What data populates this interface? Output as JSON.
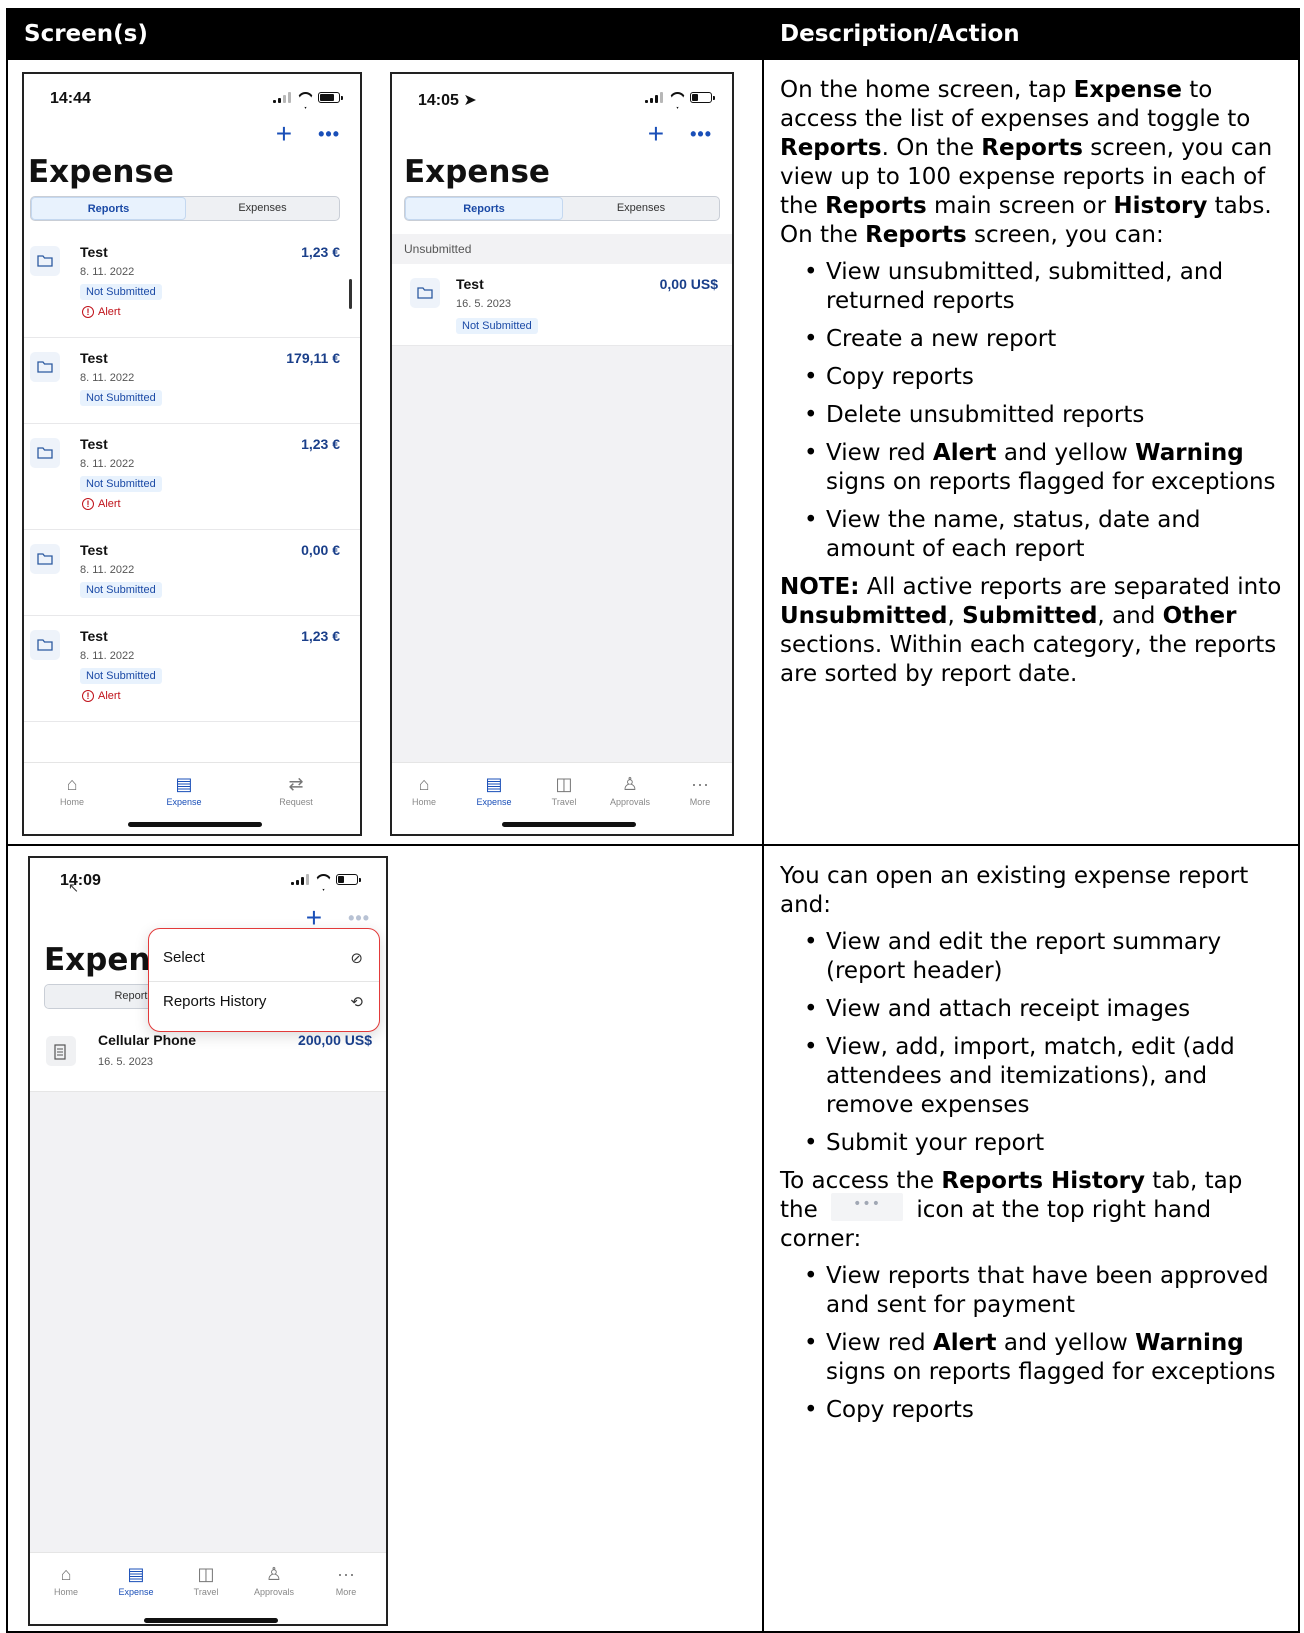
{
  "table_header": {
    "col1": "Screen(s)",
    "col2": "Description/Action"
  },
  "shot1": {
    "time": "14:44",
    "title": "Expense",
    "seg": [
      "Reports",
      "Expenses"
    ],
    "rows": [
      {
        "name": "Test",
        "date": "8. 11. 2022",
        "amount": "1,23 €",
        "status": "Not Submitted",
        "alert": "Alert"
      },
      {
        "name": "Test",
        "date": "8. 11. 2022",
        "amount": "179,11 €",
        "status": "Not Submitted",
        "alert": ""
      },
      {
        "name": "Test",
        "date": "8. 11. 2022",
        "amount": "1,23 €",
        "status": "Not Submitted",
        "alert": "Alert"
      },
      {
        "name": "Test",
        "date": "8. 11. 2022",
        "amount": "0,00 €",
        "status": "Not Submitted",
        "alert": ""
      },
      {
        "name": "Test",
        "date": "8. 11. 2022",
        "amount": "1,23 €",
        "status": "Not Submitted",
        "alert": "Alert"
      }
    ],
    "tabs": [
      "Home",
      "Expense",
      "Request"
    ]
  },
  "shot2": {
    "time": "14:05",
    "title": "Expense",
    "seg": [
      "Reports",
      "Expenses"
    ],
    "section": "Unsubmitted",
    "row": {
      "name": "Test",
      "date": "16. 5. 2023",
      "amount": "0,00 US$",
      "status": "Not Submitted"
    },
    "tabs": [
      "Home",
      "Expense",
      "Travel",
      "Approvals",
      "More"
    ]
  },
  "shot3": {
    "time": "14:09",
    "title": "Expens",
    "seg_label": "Reports",
    "menu": [
      "Select",
      "Reports History"
    ],
    "row": {
      "name": "Cellular Phone",
      "date": "16. 5. 2023",
      "amount": "200,00 US$"
    },
    "tabs": [
      "Home",
      "Expense",
      "Travel",
      "Approvals",
      "More"
    ]
  },
  "desc1": {
    "p1": [
      {
        "t": "On the home screen, tap "
      },
      {
        "b": "Expense"
      },
      {
        "t": " to access the list of expenses and toggle to "
      },
      {
        "b": "Reports"
      },
      {
        "t": ". On the "
      },
      {
        "b": "Reports"
      },
      {
        "t": " screen, you can view up to 100 expense reports in each of the "
      },
      {
        "b": "Reports"
      },
      {
        "t": " main screen or "
      },
      {
        "b": "History"
      },
      {
        "t": " tabs. On the "
      },
      {
        "b": "Reports"
      },
      {
        "t": " screen, you can:"
      }
    ],
    "bullets": [
      [
        {
          "t": "View unsubmitted, submitted, and returned reports"
        }
      ],
      [
        {
          "t": "Create a new report"
        }
      ],
      [
        {
          "t": "Copy reports"
        }
      ],
      [
        {
          "t": "Delete unsubmitted reports"
        }
      ],
      [
        {
          "t": "View red "
        },
        {
          "b": "Alert"
        },
        {
          "t": " and yellow "
        },
        {
          "b": "Warning"
        },
        {
          "t": " signs on reports flagged for exceptions"
        }
      ],
      [
        {
          "t": "View the name, status, date and amount of each report"
        }
      ]
    ],
    "note": [
      {
        "b": "NOTE:"
      },
      {
        "t": " All active reports are separated into "
      },
      {
        "b": "Unsubmitted"
      },
      {
        "t": ", "
      },
      {
        "b": "Submitted"
      },
      {
        "t": ", and "
      },
      {
        "b": "Other"
      },
      {
        "t": " sections. Within each category, the reports are sorted by report date."
      }
    ]
  },
  "desc2": {
    "p1": [
      {
        "t": "You can open an existing expense report and:"
      }
    ],
    "bullets1": [
      [
        {
          "t": "View and edit the report summary (report header)"
        }
      ],
      [
        {
          "t": "View and attach receipt images"
        }
      ],
      [
        {
          "t": "View, add, import, match, edit (add attendees and itemizations), and remove expenses"
        }
      ],
      [
        {
          "t": "Submit your report"
        }
      ]
    ],
    "p2a": [
      {
        "t": "To access the "
      },
      {
        "b": "Reports History"
      },
      {
        "t": " tab, tap the"
      }
    ],
    "more_icon": "•••",
    "p2b": [
      {
        "t": "icon at the top right hand corner:"
      }
    ],
    "bullets2": [
      [
        {
          "t": "View reports that have been approved and sent for payment"
        }
      ],
      [
        {
          "t": "View red "
        },
        {
          "b": "Alert"
        },
        {
          "t": " and yellow "
        },
        {
          "b": "Warning"
        },
        {
          "t": " signs on reports flagged for exceptions"
        }
      ],
      [
        {
          "t": "Copy reports"
        }
      ]
    ]
  }
}
